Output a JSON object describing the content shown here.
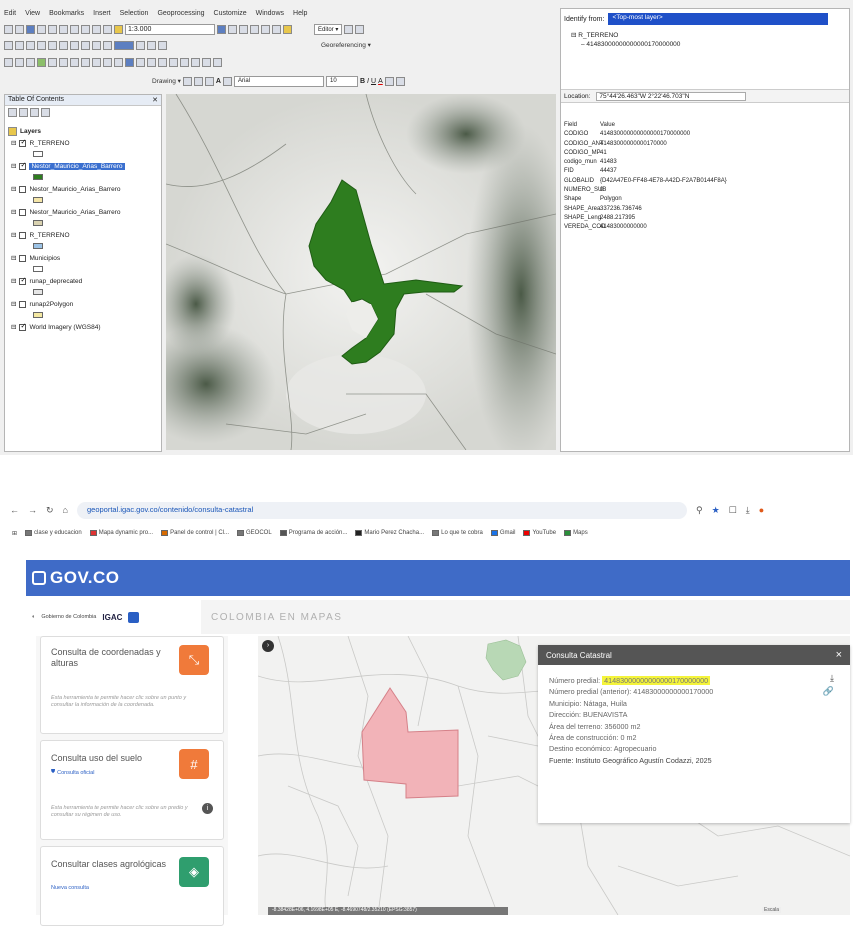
{
  "arcgis": {
    "menu": [
      "Edit",
      "View",
      "Bookmarks",
      "Insert",
      "Selection",
      "Geoprocessing",
      "Customize",
      "Windows",
      "Help"
    ],
    "scale": "1:3.000",
    "editor_label": "Editor ▾",
    "georef_label": "Georeferencing ▾",
    "drawing_label": "Drawing ▾",
    "font_name": "Arial",
    "font_size": "10",
    "toc": {
      "title": "Table Of Contents",
      "layers_label": "Layers",
      "layers": [
        {
          "name": "R_TERRENO",
          "checked": true,
          "swatch": "#ffffff"
        },
        {
          "name": "Nestor_Mauricio_Arias_Barrero",
          "checked": true,
          "selected": true,
          "swatch": "#2e7d1f"
        },
        {
          "name": "Nestor_Mauricio_Arias_Barrero",
          "checked": false,
          "swatch": "#f5e6a8"
        },
        {
          "name": "Nestor_Mauricio_Arias_Barrero",
          "checked": false,
          "swatch": "#d9d2b0"
        },
        {
          "name": "R_TERRENO",
          "checked": false,
          "swatch": "#9cc3e6"
        },
        {
          "name": "Municipios",
          "checked": false,
          "swatch": "#ffffff"
        },
        {
          "name": "runap_deprecated",
          "checked": true,
          "swatch": "#e6e6e6"
        },
        {
          "name": "runap2Polygon",
          "checked": false,
          "swatch": "#f4e8a2"
        },
        {
          "name": "World Imagery (WGS84)",
          "checked": true,
          "swatch": ""
        }
      ]
    },
    "identify": {
      "from_label": "Identify from:",
      "from_value": "<Top-most layer>",
      "tree_root": "R_TERRENO",
      "tree_child": "41483000000000000170000000",
      "location_label": "Location:",
      "location_value": "75°44'26.463\"W 2°22'46.703\"N",
      "header": {
        "field": "Field",
        "value": "Value"
      },
      "rows": [
        {
          "field": "CODIGO",
          "value": "414830000000000000170000000"
        },
        {
          "field": "CODIGO_ANT",
          "value": "41483000000000170000"
        },
        {
          "field": "CODIGO_MP",
          "value": "41"
        },
        {
          "field": "codigo_mun",
          "value": "41483"
        },
        {
          "field": "FID",
          "value": "44437"
        },
        {
          "field": "GLOBALID",
          "value": "{D42A47E0-FF48-4E78-A42D-F2A7B0144F8A}"
        },
        {
          "field": "NUMERO_SUB",
          "value": "0"
        },
        {
          "field": "Shape",
          "value": "Polygon"
        },
        {
          "field": "SHAPE_Area",
          "value": "337236.736746"
        },
        {
          "field": "SHAPE_Leng",
          "value": "2488.217395"
        },
        {
          "field": "VEREDA_COD",
          "value": "41483000000000"
        }
      ]
    }
  },
  "browser": {
    "url": "geoportal.igac.gov.co/contenido/consulta-catastral",
    "bookmarks": [
      "clase y educacion",
      "Mapa dynamic pro...",
      "Panel de control | Cl...",
      "GEOCOL",
      "Programa de acción...",
      "Mario Perez Chacha...",
      "Lo que te cobra",
      "Gmail",
      "YouTube",
      "Maps"
    ],
    "gov_logo": "GOV.CO",
    "brand_small": "Gobierno de Colombia",
    "igac": "IGAC",
    "site_title": "COLOMBIA EN MAPAS",
    "cards": [
      {
        "title": "Consulta de coordenadas y alturas",
        "desc": "Esta herramienta te permite hacer clic sobre un punto y consultar la información de la coordenada.",
        "color": "#f07a3a",
        "icon": "crosshair-icon"
      },
      {
        "title": "Consulta uso del suelo",
        "badge": "Consulta oficial",
        "desc": "Esta herramienta te permite hacer clic sobre un predio y consultar su régimen de uso.",
        "color": "#f07a3a",
        "icon": "land-use-icon"
      },
      {
        "title": "Consultar clases agrológicas",
        "badge": "Nueva consulta",
        "desc": "",
        "color": "#2f9e6e",
        "icon": "agro-icon"
      }
    ],
    "popup": {
      "title": "Consulta Catastral",
      "close": "×",
      "rows": [
        {
          "label": "Número predial:",
          "value": "41483000000000000170000000",
          "highlight": true
        },
        {
          "label": "Número predial (anterior):",
          "value": "41483000000000170000"
        },
        {
          "label": "Municipio:",
          "value": "Nátaga, Huila"
        },
        {
          "label": "Dirección:",
          "value": "BUENAVISTA"
        },
        {
          "label": "Área del terreno:",
          "value": "356000 m2"
        },
        {
          "label": "Área de construcción:",
          "value": "0 m2"
        },
        {
          "label": "Destino económico:",
          "value": "Agropecuario"
        },
        {
          "label": "Fuente:",
          "value": "Instituto Geográfico Agustín Codazzi, 2025"
        }
      ]
    },
    "coords": "-8.38428E+06, 4.1698E+05 E, -8.4690748/2.35210 (EPSG:3857)",
    "zoom": "Escala"
  }
}
